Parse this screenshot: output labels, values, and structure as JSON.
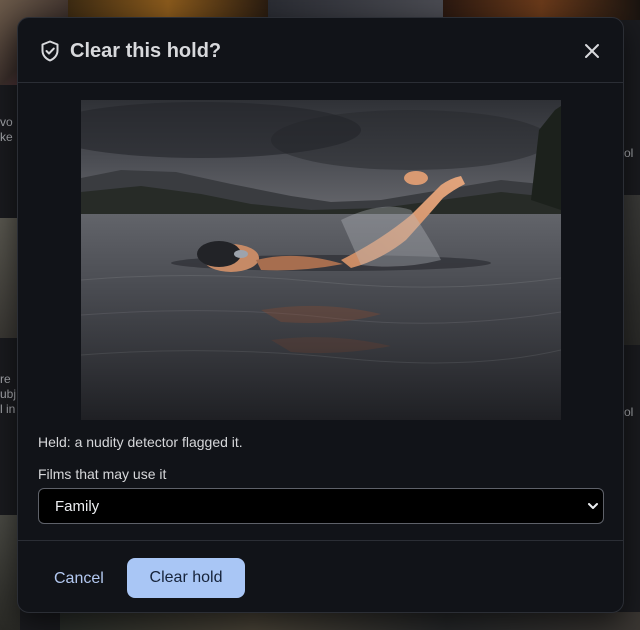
{
  "background": {
    "text_left_top": "vo\nke",
    "text_left_bottom": "re\nubj\nl in",
    "text_right_top": "ol",
    "text_right_bottom": "ol"
  },
  "dialog": {
    "title": "Clear this hold?",
    "title_icon": "shield-check-icon",
    "close_icon": "close-icon",
    "image_subject": "swimmer on a lake",
    "held_text": "Held: a nudity detector flagged it.",
    "films_label": "Films that may use it",
    "films_select": {
      "value": "Family",
      "options": [
        "Family"
      ]
    },
    "cancel_label": "Cancel",
    "clear_label": "Clear hold",
    "accent_color": "#a9c6f5"
  }
}
